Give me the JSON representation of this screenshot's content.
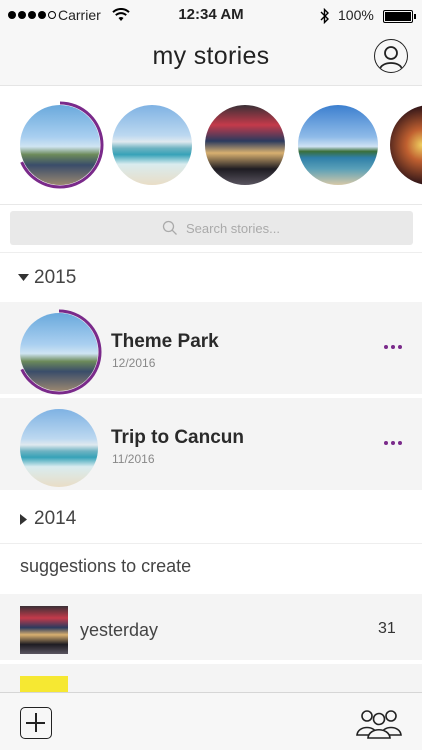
{
  "status_bar": {
    "carrier": "Carrier",
    "time": "12:34 AM",
    "battery": "100%"
  },
  "nav": {
    "title": "my stories"
  },
  "stories_row": [
    {
      "name": "theme-park",
      "ring": true
    },
    {
      "name": "beach"
    },
    {
      "name": "city"
    },
    {
      "name": "bay"
    },
    {
      "name": "night"
    }
  ],
  "search": {
    "placeholder": "Search stories..."
  },
  "years": [
    {
      "label": "2015",
      "expanded": true
    },
    {
      "label": "2014",
      "expanded": false
    }
  ],
  "stories": [
    {
      "title": "Theme Park",
      "date": "12/2016"
    },
    {
      "title": "Trip to Cancun",
      "date": "11/2016"
    }
  ],
  "suggestions": {
    "title": "suggestions to create",
    "items": [
      {
        "label": "yesterday",
        "count": "31"
      }
    ]
  },
  "colors": {
    "accent": "#7a2a8a"
  }
}
